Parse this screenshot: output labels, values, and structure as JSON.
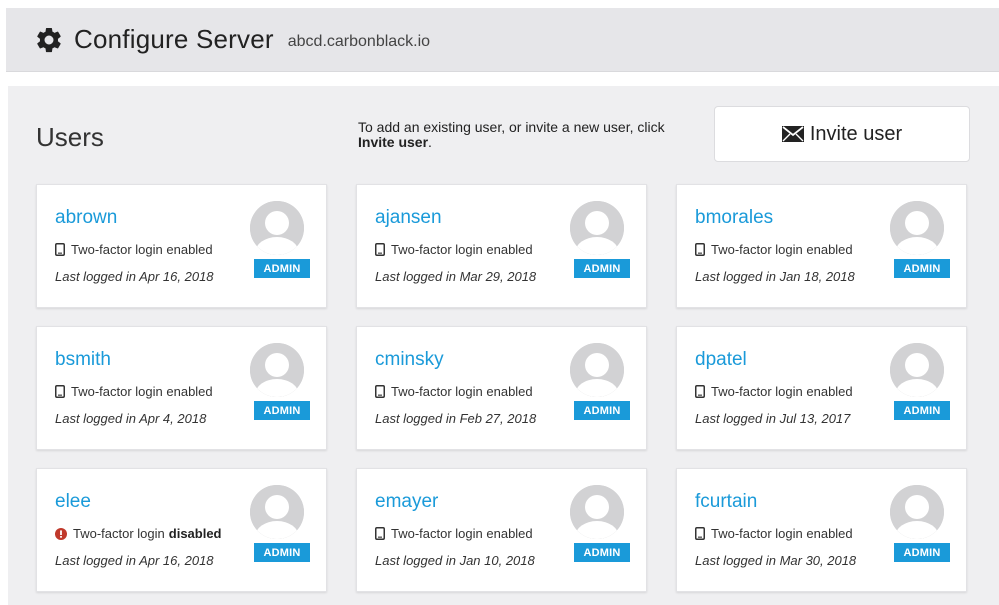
{
  "header": {
    "title": "Configure Server",
    "host": "abcd.carbonblack.io"
  },
  "users_section": {
    "title": "Users",
    "help_prefix": "To add an existing user, or invite a new user, click ",
    "help_bold": "Invite user",
    "help_suffix": ".",
    "invite_label": "Invite user"
  },
  "colors": {
    "link": "#1a9ad9",
    "badge": "#1a9ad9",
    "error": "#c0392b",
    "panel_bg": "#efeff1"
  },
  "users": [
    {
      "username": "abrown",
      "twofactor": "Two-factor login enabled",
      "twofactor_status": "",
      "last_login": "Last logged in Apr 16, 2018",
      "role": "ADMIN",
      "icon": "phone-icon"
    },
    {
      "username": "ajansen",
      "twofactor": "Two-factor login enabled",
      "twofactor_status": "",
      "last_login": "Last logged in Mar 29, 2018",
      "role": "ADMIN",
      "icon": "phone-icon"
    },
    {
      "username": "bmorales",
      "twofactor": "Two-factor login enabled",
      "twofactor_status": "",
      "last_login": "Last logged in Jan 18, 2018",
      "role": "ADMIN",
      "icon": "phone-icon"
    },
    {
      "username": "bsmith",
      "twofactor": "Two-factor login enabled",
      "twofactor_status": "",
      "last_login": "Last logged in Apr 4, 2018",
      "role": "ADMIN",
      "icon": "phone-icon"
    },
    {
      "username": "cminsky",
      "twofactor": "Two-factor login enabled",
      "twofactor_status": "",
      "last_login": "Last logged in Feb 27, 2018",
      "role": "ADMIN",
      "icon": "phone-icon"
    },
    {
      "username": "dpatel",
      "twofactor": "Two-factor login enabled",
      "twofactor_status": "",
      "last_login": "Last logged in Jul 13, 2017",
      "role": "ADMIN",
      "icon": "phone-icon"
    },
    {
      "username": "elee",
      "twofactor": "Two-factor login",
      "twofactor_status": "disabled",
      "last_login": "Last logged in Apr 16, 2018",
      "role": "ADMIN",
      "icon": "alert-icon"
    },
    {
      "username": "emayer",
      "twofactor": "Two-factor login enabled",
      "twofactor_status": "",
      "last_login": "Last logged in Jan 10, 2018",
      "role": "ADMIN",
      "icon": "phone-icon"
    },
    {
      "username": "fcurtain",
      "twofactor": "Two-factor login enabled",
      "twofactor_status": "",
      "last_login": "Last logged in Mar 30, 2018",
      "role": "ADMIN",
      "icon": "phone-icon"
    }
  ]
}
